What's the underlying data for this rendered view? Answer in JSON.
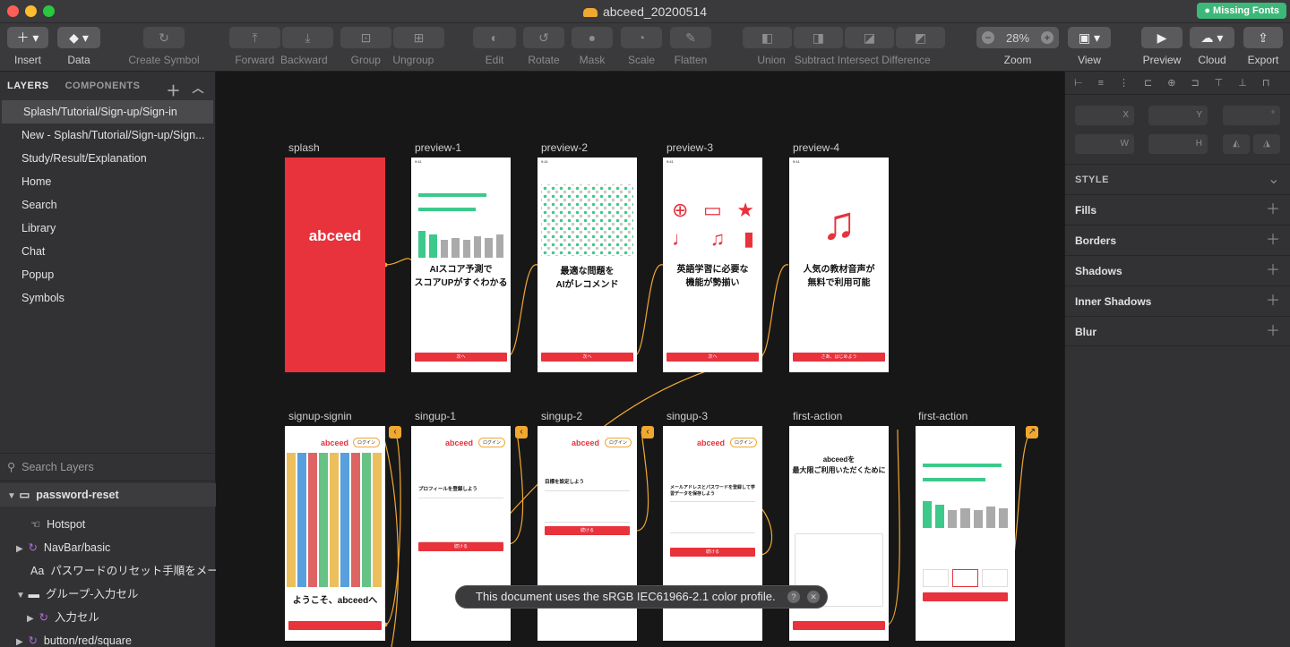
{
  "window": {
    "title": "abceed_20200514",
    "missing_fonts": "● Missing Fonts"
  },
  "toolbar": {
    "insert": "Insert",
    "data": "Data",
    "create_symbol": "Create Symbol",
    "forward": "Forward",
    "backward": "Backward",
    "group": "Group",
    "ungroup": "Ungroup",
    "edit": "Edit",
    "rotate": "Rotate",
    "mask": "Mask",
    "scale": "Scale",
    "flatten": "Flatten",
    "union": "Union",
    "subtract": "Subtract",
    "intersect": "Intersect",
    "difference": "Difference",
    "zoom": "Zoom",
    "zoom_value": "28%",
    "view": "View",
    "preview": "Preview",
    "cloud": "Cloud",
    "export": "Export"
  },
  "left_panel": {
    "tabs": [
      "LAYERS",
      "COMPONENTS"
    ],
    "pages": [
      "Splash/Tutorial/Sign-up/Sign-in",
      "New - Splash/Tutorial/Sign-up/Sign...",
      "Study/Result/Explanation",
      "Home",
      "Search",
      "Library",
      "Chat",
      "Popup",
      "Symbols"
    ],
    "search_placeholder": "Search Layers",
    "layers": [
      {
        "name": "password-reset"
      },
      {
        "name": "Hotspot"
      },
      {
        "name": "NavBar/basic"
      },
      {
        "name": "パスワードのリセット手順をメー..."
      },
      {
        "name": "グループ-入力セル"
      },
      {
        "name": "入力セル"
      },
      {
        "name": "button/red/square"
      }
    ]
  },
  "canvas": {
    "artboards_row1": [
      "splash",
      "preview-1",
      "preview-2",
      "preview-3",
      "preview-4"
    ],
    "artboards_row2": [
      "signup-signin",
      "singup-1",
      "singup-2",
      "singup-3",
      "first-action",
      "first-action"
    ],
    "splash_brand": "abceed",
    "preview1_title": "AIスコア予測で\nスコアUPがすぐわかる",
    "preview2_title": "最適な問題を\nAIがレコメンド",
    "preview3_title": "英語学習に必要な\n機能が勢揃い",
    "preview4_title": "人気の教材音声が\n無料で利用可能",
    "next_btn": "次へ",
    "start_btn": "さあ、はじめよう",
    "login": "ログイン",
    "welcome": "ようこそ、abceedへ",
    "signup1_heading": "プロフィールを登録しよう",
    "signup2_heading": "目標を設定しよう",
    "signup3_heading": "メールアドレスとパスワードを登録して学習データを保存しよう",
    "continue_btn": "続ける",
    "first_action_title": "abceedを\n最大限ご利用いただくために",
    "toast": "This document uses the sRGB IEC61966-2.1 color profile."
  },
  "right_panel": {
    "fields": [
      "X",
      "Y",
      "°",
      "W",
      "H"
    ],
    "sections": [
      "STYLE",
      "Fills",
      "Borders",
      "Shadows",
      "Inner Shadows",
      "Blur"
    ]
  }
}
